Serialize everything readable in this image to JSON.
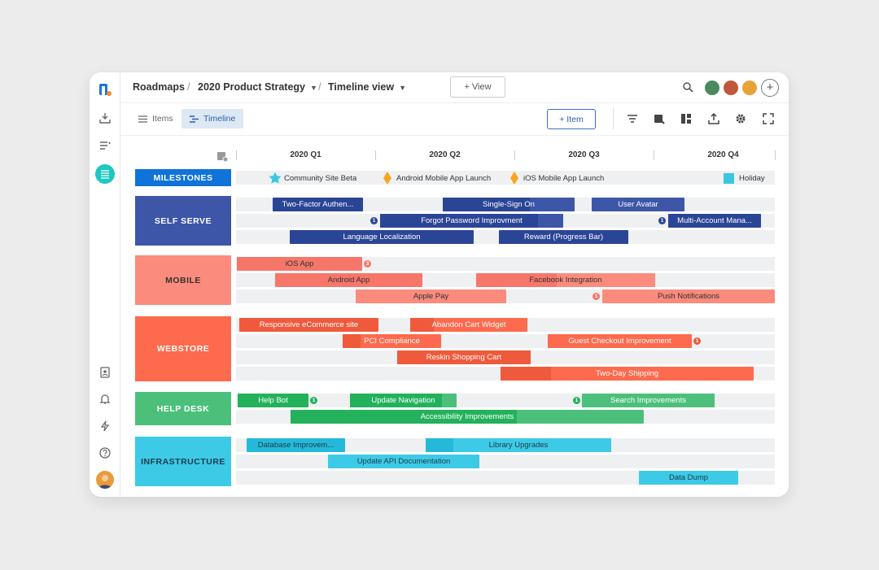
{
  "breadcrumb": {
    "root": "Roadmaps",
    "sep1": "/",
    "roadmap": "2020 Product Strategy",
    "sep2": "/",
    "view": "Timeline view"
  },
  "view_button": "+ View",
  "tabs": {
    "items": "Items",
    "timeline": "Timeline"
  },
  "item_button": "+ Item",
  "quarters": [
    "2020 Q1",
    "2020 Q2",
    "2020 Q3",
    "2020 Q4"
  ],
  "colors": {
    "milestones": "#0f73d9",
    "self_serve": "#3d56a8",
    "self_serve_bar": "#3d56a8",
    "self_serve_dark": "#2b4596",
    "mobile": "#fb8b7d",
    "mobile_dark": "#f7766a",
    "webstore": "#fe6a4d",
    "webstore_dark": "#ef5a3c",
    "help_desk": "#4cc07a",
    "help_desk_dark": "#23b25b",
    "infrastructure": "#3dcae6",
    "infrastructure_dark": "#24b9d9"
  },
  "milestones": {
    "label": "MILESTONES",
    "items": [
      {
        "label": "Community Site Beta",
        "icon": "star-icon"
      },
      {
        "label": "Android Mobile App Launch",
        "icon": "diamond-icon"
      },
      {
        "label": "iOS Mobile App Launch",
        "icon": "diamond-icon"
      },
      {
        "label": "Holiday",
        "icon": "holiday-square-icon"
      }
    ]
  },
  "groups": {
    "self_serve": {
      "label": "SELF SERVE",
      "bars": [
        "Two-Factor Authen...",
        "Single-Sign On",
        "User Avatar",
        "Forgot Password Improvment",
        "Multi-Account Mana...",
        "Language Localization",
        "Reward (Progress Bar)"
      ],
      "badges": [
        "1",
        "1"
      ]
    },
    "mobile": {
      "label": "MOBILE",
      "bars": [
        "iOS App",
        "Android App",
        "Facebook Integration",
        "Apple Pay",
        "Push Notifications"
      ],
      "badges": [
        "3",
        "1"
      ]
    },
    "webstore": {
      "label": "WEBSTORE",
      "bars": [
        "Responsive eCommerce site",
        "Abandon Cart Widget",
        "PCI Compliance",
        "Guest Checkout Improvement",
        "Reskin Shopping Cart",
        "Two-Day Shipping"
      ],
      "badges": [
        "1"
      ]
    },
    "help_desk": {
      "label": "HELP DESK",
      "bars": [
        "Help Bot",
        "Update Navigation",
        "Search Improvements",
        "Accessibility Improvements"
      ],
      "badges": [
        "1",
        "1"
      ]
    },
    "infrastructure": {
      "label": "INFRASTRUCTURE",
      "bars": [
        "Database Improvem...",
        "Library Upgrades",
        "Update API Documentation",
        "Data Dump"
      ]
    }
  }
}
